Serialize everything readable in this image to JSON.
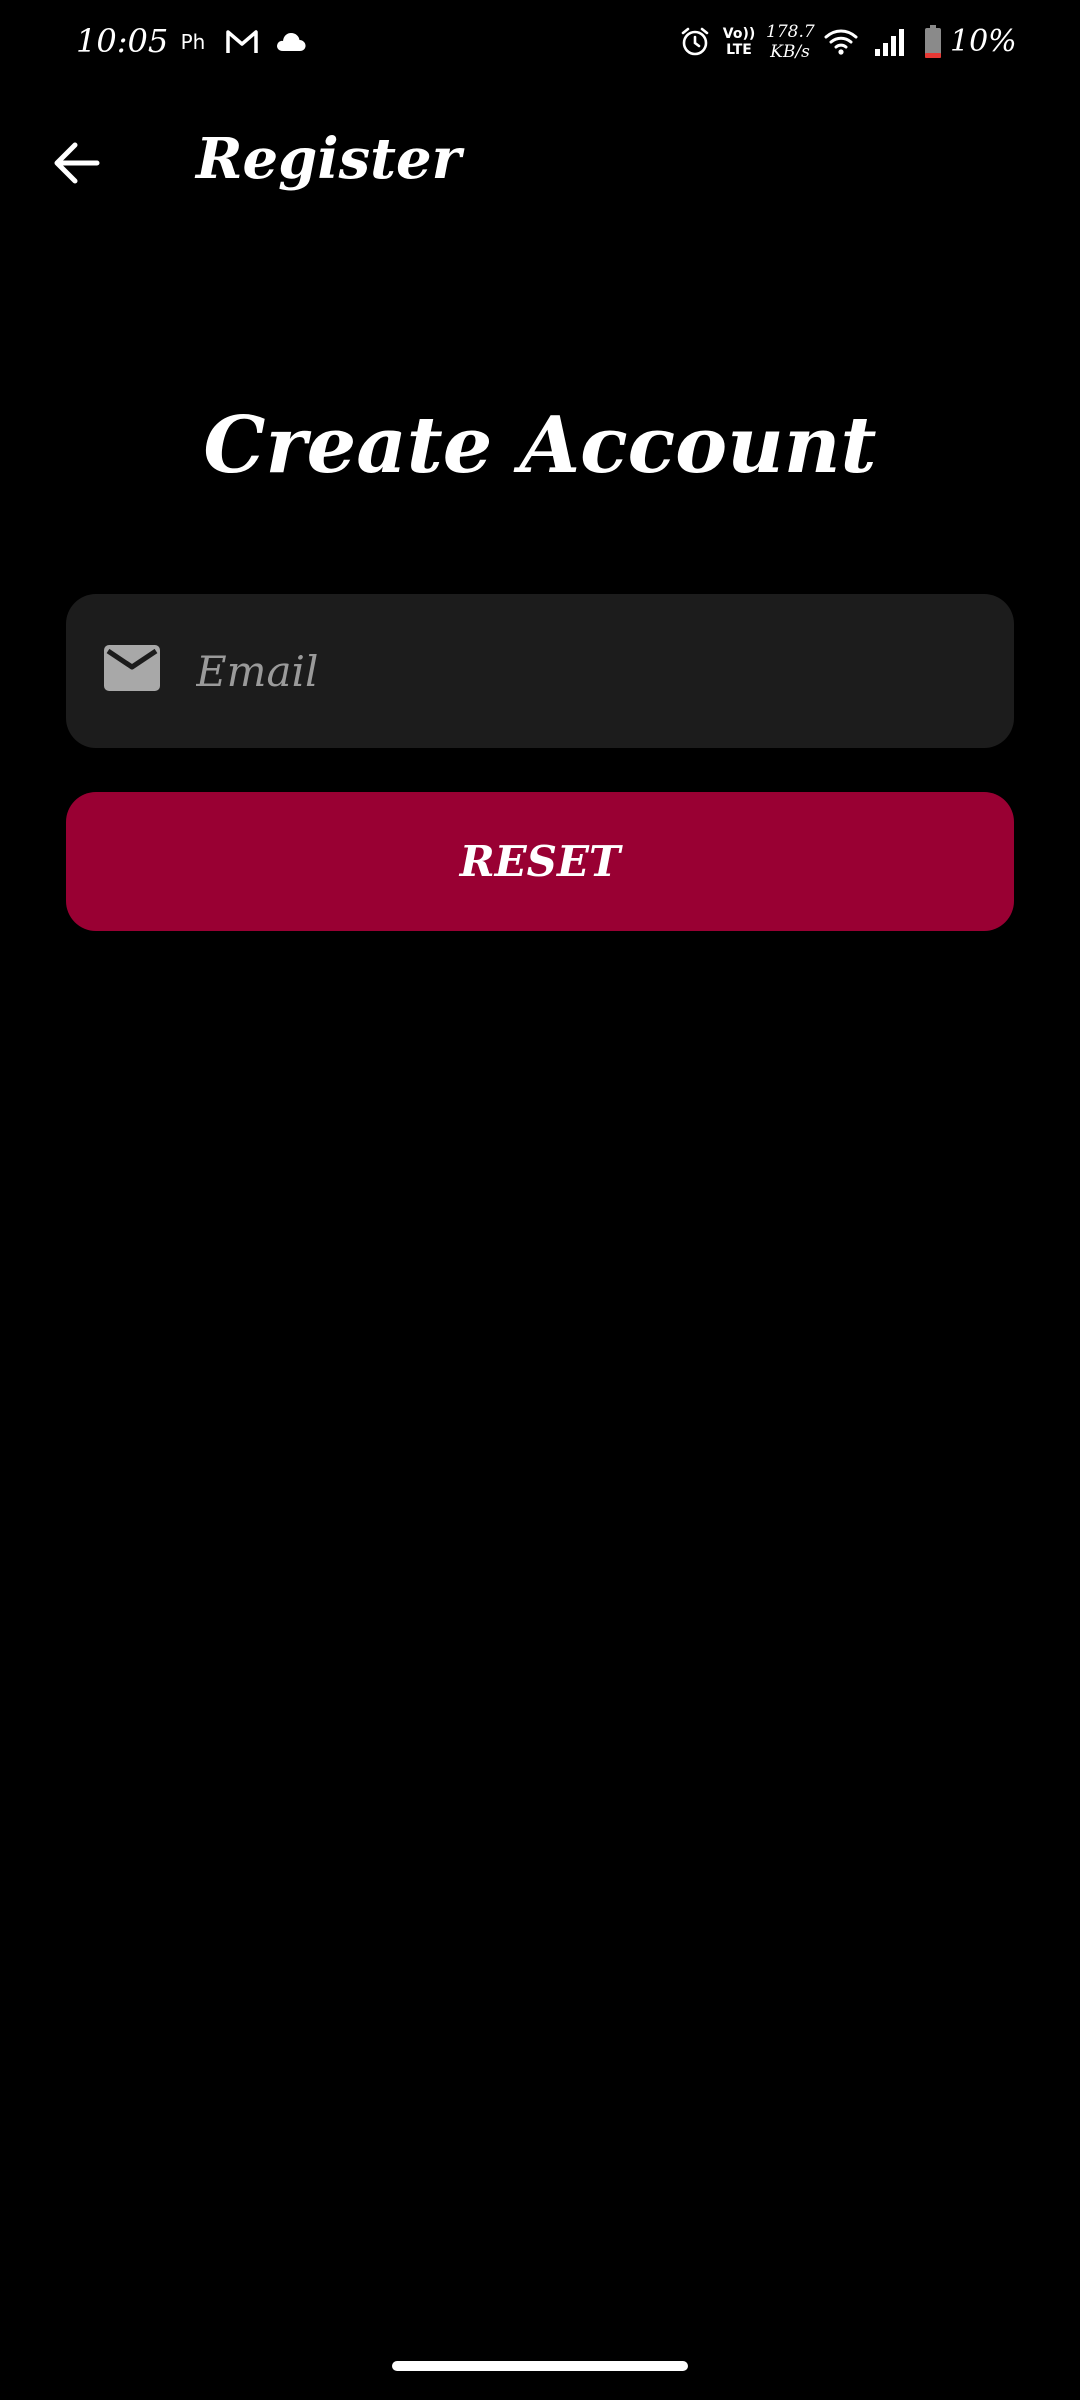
{
  "status_bar": {
    "time": "10:05",
    "notification_icons": [
      "ph-app-icon",
      "gmail-icon",
      "cloud-icon"
    ],
    "ph_text": "Ph",
    "volte_top": "Vo))",
    "volte_bottom": "LTE",
    "speed_value": "178.7",
    "speed_unit": "KB/s",
    "battery_percent": "10%",
    "battery_color": "#e53935"
  },
  "app_bar": {
    "back_icon": "arrow-left-icon",
    "title": "Register"
  },
  "form": {
    "heading": "Create Account",
    "email": {
      "icon": "mail-icon",
      "placeholder": "Email",
      "value": ""
    },
    "reset_label": "RESET"
  },
  "colors": {
    "background": "#000000",
    "field_background": "#1c1c1c",
    "accent": "#990033",
    "placeholder": "#9a9a9a"
  }
}
